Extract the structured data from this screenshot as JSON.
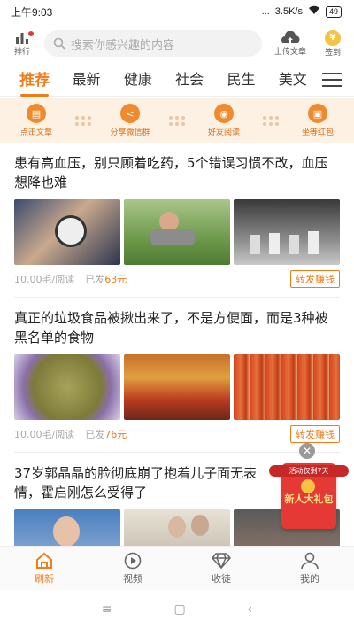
{
  "status": {
    "time": "上午9:03",
    "signal": "...",
    "speed": "3.5K/s",
    "battery": "49"
  },
  "topbar": {
    "rank_label": "排行",
    "search_placeholder": "搜索你感兴趣的内容",
    "upload_label": "上传文章",
    "signin_label": "签到"
  },
  "tabs": [
    "推荐",
    "最新",
    "健康",
    "社会",
    "民生",
    "美文"
  ],
  "actions": [
    {
      "label": "点击文章"
    },
    {
      "label": "分享微信群"
    },
    {
      "label": "好友阅读"
    },
    {
      "label": "坐等红包"
    }
  ],
  "articles": [
    {
      "title": "患有高血压，别只顾着吃药，5个错误习惯不改，血压想降也难",
      "rate": "10.00毛/阅读",
      "sent_prefix": "已发",
      "sent_amount": "63元",
      "share_label": "转发赚钱"
    },
    {
      "title": "真正的垃圾食品被揪出来了，不是方便面，而是3种被黑名单的食物",
      "rate": "10.00毛/阅读",
      "sent_prefix": "已发",
      "sent_amount": "76元",
      "share_label": "转发赚钱"
    },
    {
      "title": "37岁郭晶晶的脸彻底崩了抱着儿子面无表情，霍启刚怎么受得了"
    }
  ],
  "promo": {
    "tag": "活动仅剩7天",
    "text": "新人大礼包"
  },
  "bottomnav": [
    {
      "label": "刷新"
    },
    {
      "label": "视频"
    },
    {
      "label": "收徒"
    },
    {
      "label": "我的"
    }
  ],
  "colors": {
    "accent": "#f07c1a",
    "action_bg": "#fdf1e4"
  }
}
